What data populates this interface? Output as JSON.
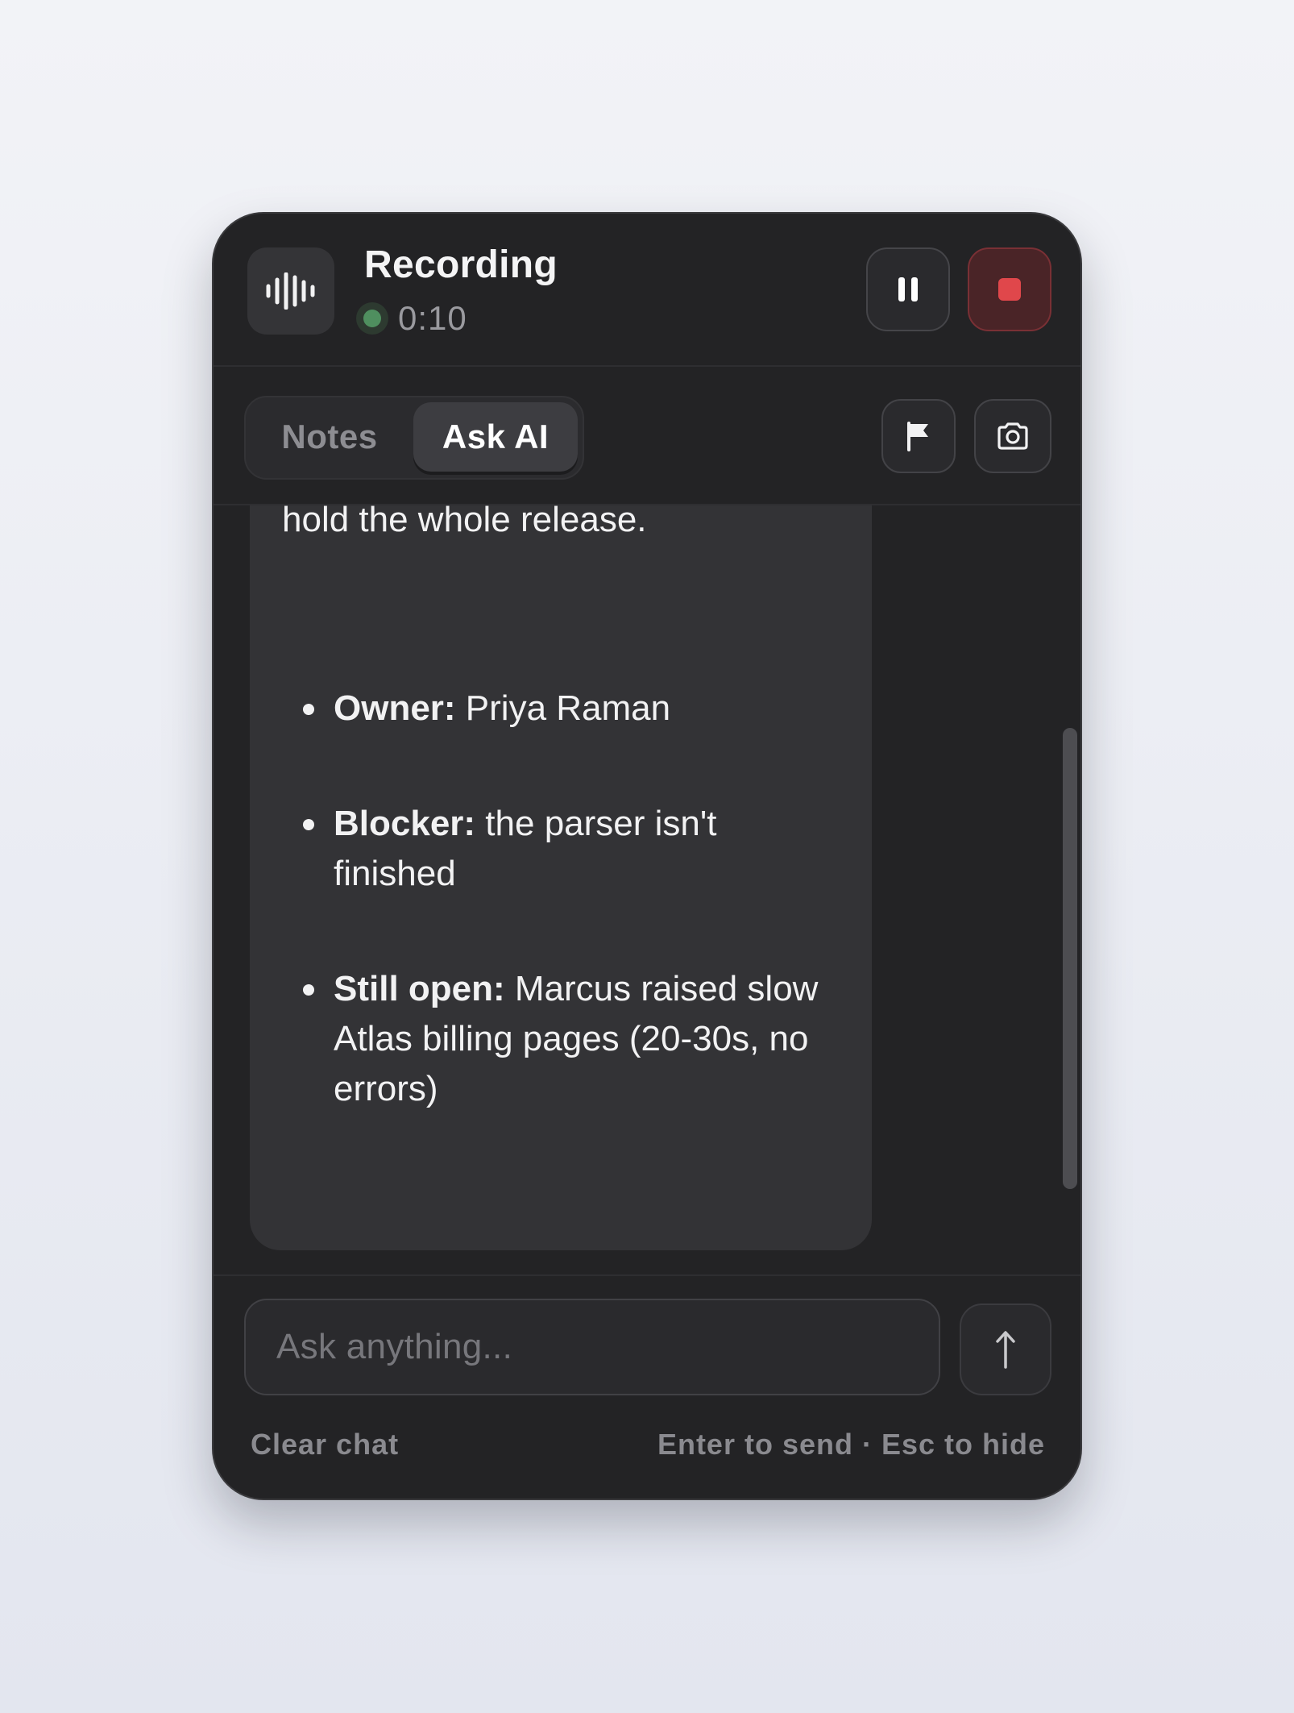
{
  "header": {
    "title": "Recording",
    "timer": "0:10",
    "status_color": "#4f8f5f",
    "icons": {
      "logo": "waveform-icon",
      "pause": "pause-icon",
      "stop": "stop-icon"
    },
    "stop_color": "#e0474b"
  },
  "tabs": [
    {
      "label": "Notes",
      "active": false
    },
    {
      "label": "Ask AI",
      "active": true
    }
  ],
  "toolbar": {
    "icons": [
      "flag-icon",
      "camera-icon"
    ]
  },
  "message": {
    "text": "hold the whole release.",
    "bullets": [
      {
        "label": "Owner:",
        "text": " Priya Raman"
      },
      {
        "label": "Blocker:",
        "text": " the parser isn't finished"
      },
      {
        "label": "Still open:",
        "text": " Marcus raised slow Atlas billing pages (20-30s, no errors)"
      }
    ]
  },
  "input": {
    "placeholder": "Ask anything...",
    "send_icon": "arrow-up-icon"
  },
  "footer": {
    "clear_label": "Clear chat",
    "hint": "Enter to send · Esc to hide"
  }
}
